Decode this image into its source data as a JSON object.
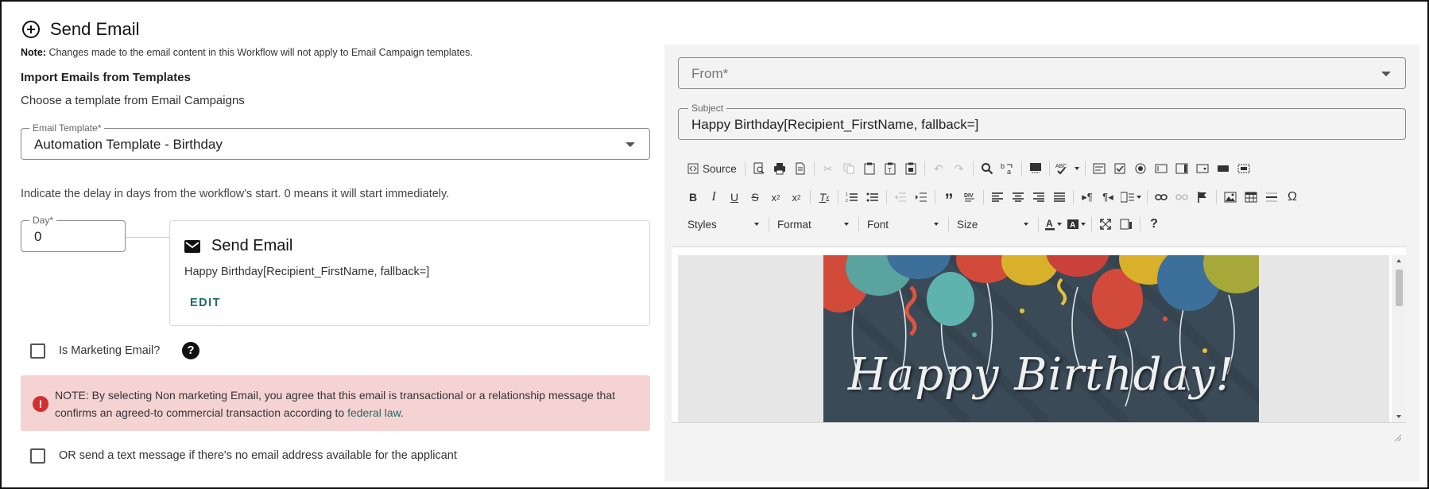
{
  "header": {
    "title": "Send Email"
  },
  "note": {
    "label": "Note:",
    "text": "Changes made to the email content in this Workflow will not apply to Email Campaign templates."
  },
  "import": {
    "title": "Import Emails from Templates",
    "subtitle": "Choose a template from Email Campaigns"
  },
  "email_template": {
    "label": "Email Template*",
    "value": "Automation Template - Birthday"
  },
  "delay": {
    "text": "Indicate the delay in days from the workflow's start. 0 means it will start immediately.",
    "day_label": "Day*",
    "day_value": "0"
  },
  "step_card": {
    "title": "Send Email",
    "subject": "Happy Birthday[Recipient_FirstName, fallback=]",
    "edit_label": "EDIT"
  },
  "marketing": {
    "label": "Is Marketing Email?",
    "checked": false,
    "help_icon": "help-circle-icon"
  },
  "alert": {
    "text": "NOTE: By selecting Non marketing Email, you agree that this email is transactional or a relationship message that confirms an agreed-to commercial transaction according to",
    "link": "federal law",
    "suffix": ".",
    "color": "#f5d3d3",
    "icon_color": "#d32f2f"
  },
  "sms_fallback": {
    "label": "OR send a text message if there's no email address available for the applicant",
    "checked": false
  },
  "from_field": {
    "placeholder": "From*"
  },
  "subject_field": {
    "label": "Subject",
    "value": "Happy Birthday[Recipient_FirstName, fallback=]"
  },
  "toolbar": {
    "source_label": "Source",
    "styles_label": "Styles",
    "format_label": "Format",
    "font_label": "Font",
    "size_label": "Size",
    "special_char": "Ω",
    "help_char": "?"
  },
  "editor": {
    "banner_text": "Happy Birthday!"
  },
  "colors": {
    "accent": "#1d6e64",
    "panel": "#f3f3f3",
    "banner_bg": "#3b4a57"
  }
}
